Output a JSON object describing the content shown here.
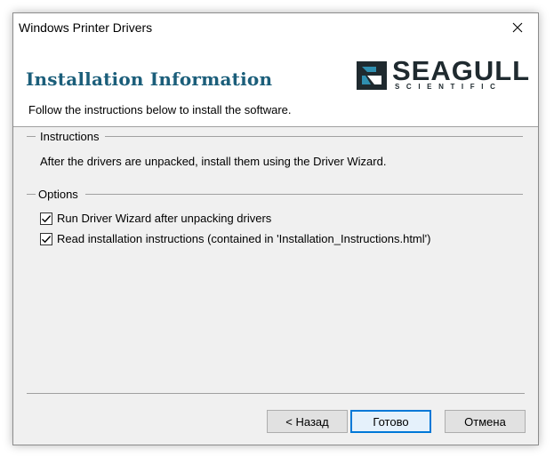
{
  "window": {
    "title": "Windows Printer Drivers"
  },
  "header": {
    "title": "Installation Information",
    "subtitle": "Follow the instructions below to install the software.",
    "logo_text": "SEAGULL",
    "logo_subtext": "SCIENTIFIC"
  },
  "instructions": {
    "group_label": "Instructions",
    "text": "After the drivers are unpacked, install them using the Driver Wizard."
  },
  "options": {
    "group_label": "Options",
    "items": [
      {
        "label": "Run Driver Wizard after unpacking drivers",
        "checked": true
      },
      {
        "label": "Read installation instructions (contained in 'Installation_Instructions.html')",
        "checked": true
      }
    ]
  },
  "buttons": {
    "back": "< Назад",
    "finish": "Готово",
    "cancel": "Отмена"
  },
  "colors": {
    "header_title": "#1b5e7a",
    "dialog_bg": "#f0f0f0",
    "default_button_border": "#0078d7"
  }
}
